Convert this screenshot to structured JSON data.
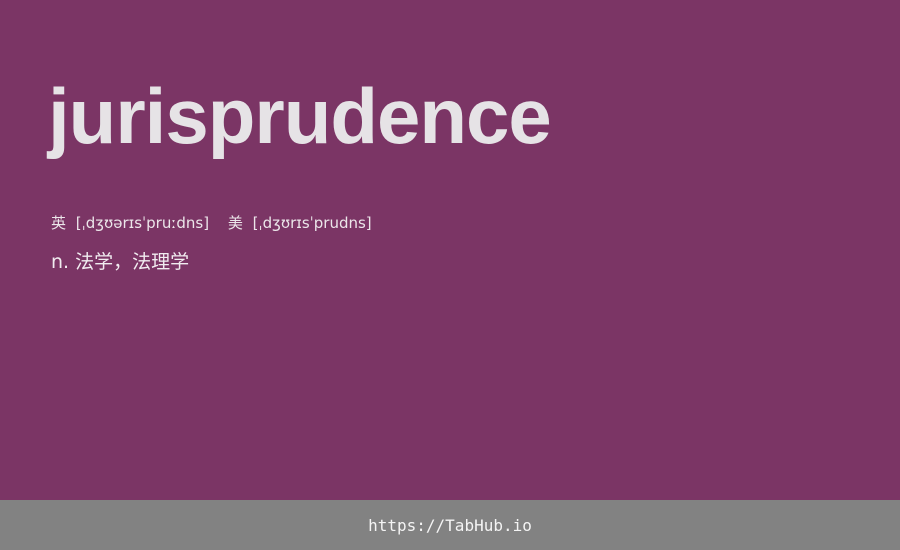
{
  "word": "jurisprudence",
  "pronunciation": {
    "uk_label": "英",
    "uk_ipa": "[ˌdʒʊərɪsˈpruːdns]",
    "us_label": "美",
    "us_ipa": "[ˌdʒʊrɪsˈprudns]"
  },
  "definition": "n. 法学，法理学",
  "footer": {
    "link_text": "https://TabHub.io"
  },
  "colors": {
    "background": "#7b3565",
    "footer_background": "#828282",
    "text": "#e6e3e6"
  }
}
